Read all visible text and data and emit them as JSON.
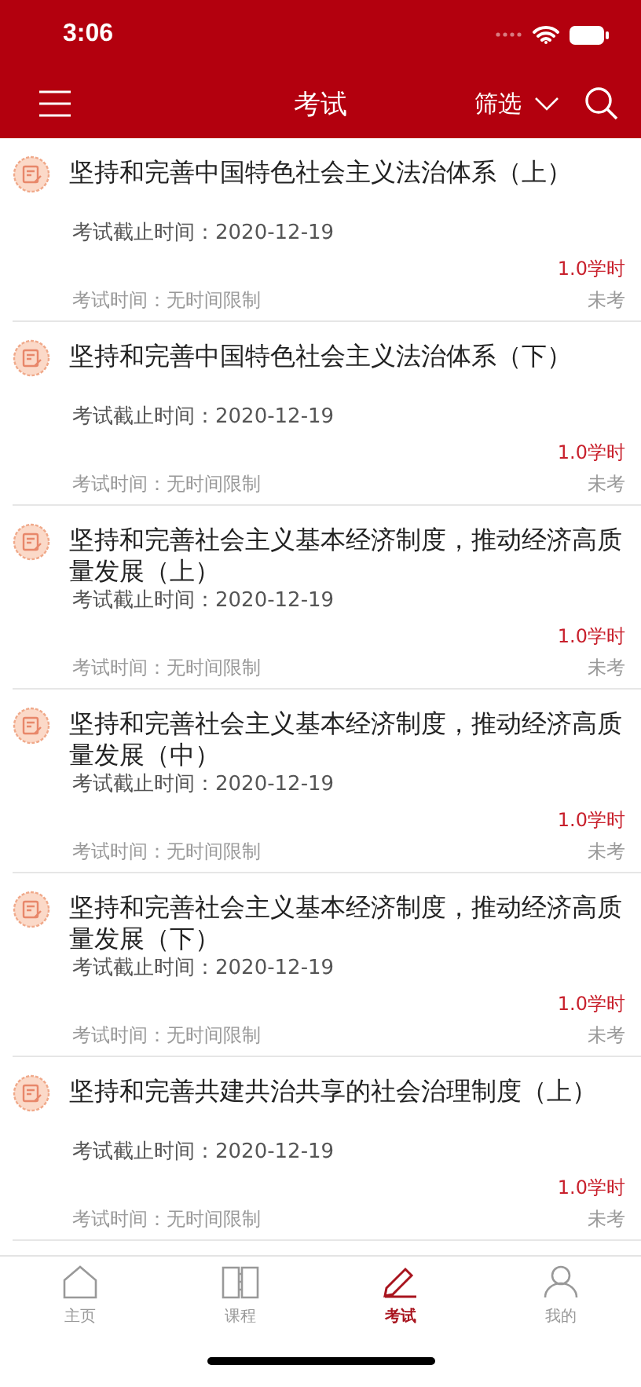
{
  "status_bar": {
    "time": "3:06"
  },
  "nav_bar": {
    "title": "考试",
    "filter": "筛选"
  },
  "exams": [
    {
      "title": "坚持和完善中国特色社会主义法治体系（上）",
      "deadline": "考试截止时间：2020-12-19",
      "hours": "1.0学时",
      "duration": "考试时间：无时间限制",
      "status": "未考"
    },
    {
      "title": "坚持和完善中国特色社会主义法治体系（下）",
      "deadline": "考试截止时间：2020-12-19",
      "hours": "1.0学时",
      "duration": "考试时间：无时间限制",
      "status": "未考"
    },
    {
      "title": "坚持和完善社会主义基本经济制度，推动经济高质量发展（上）",
      "deadline": "考试截止时间：2020-12-19",
      "hours": "1.0学时",
      "duration": "考试时间：无时间限制",
      "status": "未考"
    },
    {
      "title": "坚持和完善社会主义基本经济制度，推动经济高质量发展（中）",
      "deadline": "考试截止时间：2020-12-19",
      "hours": "1.0学时",
      "duration": "考试时间：无时间限制",
      "status": "未考"
    },
    {
      "title": "坚持和完善社会主义基本经济制度，推动经济高质量发展（下）",
      "deadline": "考试截止时间：2020-12-19",
      "hours": "1.0学时",
      "duration": "考试时间：无时间限制",
      "status": "未考"
    },
    {
      "title": "坚持和完善共建共治共享的社会治理制度（上）",
      "deadline": "考试截止时间：2020-12-19",
      "hours": "1.0学时",
      "duration": "考试时间：无时间限制",
      "status": "未考"
    }
  ],
  "tab_bar": [
    {
      "kind": "home",
      "label": "主页",
      "selected": false
    },
    {
      "kind": "book",
      "label": "课程",
      "selected": false
    },
    {
      "kind": "pencil",
      "label": "考试",
      "selected": true
    },
    {
      "kind": "person",
      "label": "我的",
      "selected": false
    }
  ]
}
